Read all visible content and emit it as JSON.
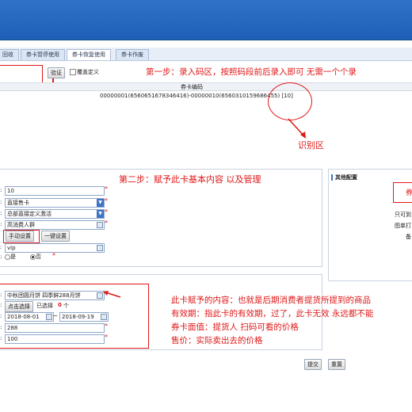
{
  "tabs": [
    "回收",
    "券卡暂停使用",
    "券卡恢复使用",
    "券卡作废"
  ],
  "code_area": {
    "verify_label": "验证",
    "overwrite_label": "覆盖定义",
    "column_header": "券卡编码",
    "code_range": "00000001(6560651678346416)-00000010(6560310159686455) [10]"
  },
  "annotations": {
    "step1": "第一步：录入码区，按照码段前后录入即可   无需一个个录",
    "recognize": "识别区",
    "step2": "第二步：赋予此卡基本内容  以及管理",
    "content_line1": "此卡赋予的内容：也就是后期消费者提货所提到的商品",
    "content_line2": "有效期：指此卡的有效期，过了，此卡无效  永远都不能",
    "content_line3": "券卡面值：提货人  扫码可看的价格",
    "content_line4": "售价：实际卖出去的价格"
  },
  "basic": {
    "quantity": "10",
    "type": "直接售卡",
    "template": "总部直接定义激活",
    "audience": "高消费人群",
    "manual_button": "手动设置",
    "one_key_button": "一键设置",
    "level": "vip",
    "radio_yes": "是",
    "radio_no": "否"
  },
  "other_config": {
    "title": "其他配置",
    "box_text": "券",
    "line1": "只可到",
    "line2": "图单打",
    "line3": "备"
  },
  "content": {
    "product": "中秋团圆月饼 四季鲜288月饼",
    "select_button": "点击选择",
    "selected_prefix": "已选择",
    "selected_count": "0",
    "selected_suffix": "个",
    "date_start": "2018-08-01",
    "date_sep": "~",
    "date_end": "2018-09-19",
    "face_value": "288",
    "price": "100"
  },
  "footer": {
    "submit": "提交",
    "reset": "重置"
  },
  "colors": {
    "annotation": "#e01818",
    "header_blue": "#1d5fb6"
  }
}
